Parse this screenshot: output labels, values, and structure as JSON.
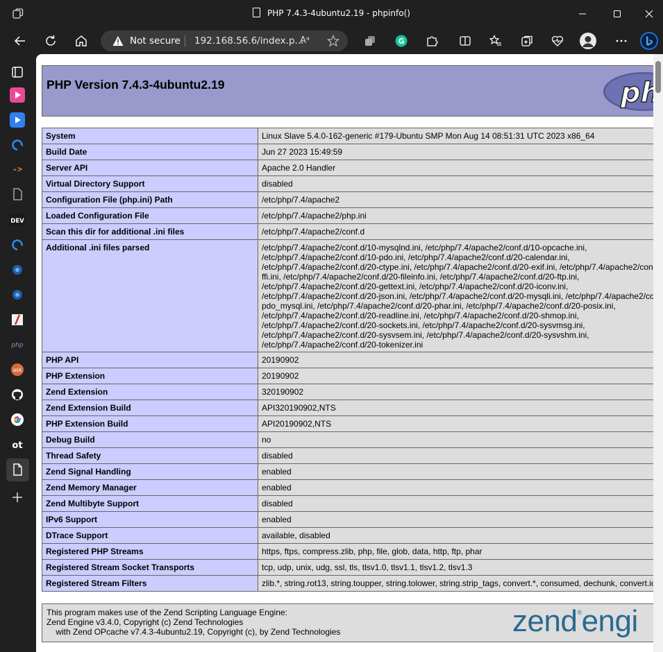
{
  "window": {
    "title": "PHP 7.4.3-4ubuntu2.19 - phpinfo()"
  },
  "toolbar": {
    "security_label": "Not secure",
    "url": "192.168.56.6/index.p...",
    "read_aloud_label": "Aᵃ"
  },
  "sidebar": {
    "items": [
      {
        "name": "tab-actions-icon"
      },
      {
        "name": "pink-app-icon"
      },
      {
        "name": "blue-app-icon"
      },
      {
        "name": "refresh-site-icon"
      },
      {
        "name": "arrow-site-icon"
      },
      {
        "name": "document-icon"
      },
      {
        "name": "dev-icon",
        "label": "DEV"
      },
      {
        "name": "site-icon-1"
      },
      {
        "name": "site-icon-2"
      },
      {
        "name": "site-icon-3"
      },
      {
        "name": "slash-site-icon"
      },
      {
        "name": "php-site-icon",
        "label": "php"
      },
      {
        "name": "ask-site-icon",
        "label": "ask"
      },
      {
        "name": "github-icon"
      },
      {
        "name": "google-icon"
      },
      {
        "name": "ot-icon",
        "label": "ot"
      },
      {
        "name": "page-icon"
      },
      {
        "name": "add-icon"
      }
    ]
  },
  "phpinfo": {
    "heading": "PHP Version 7.4.3-4ubuntu2.19",
    "rows": [
      {
        "key": "System",
        "value": "Linux Slave 5.4.0-162-generic #179-Ubuntu SMP Mon Aug 14 08:51:31 UTC 2023 x86_64"
      },
      {
        "key": "Build Date",
        "value": "Jun 27 2023 15:49:59"
      },
      {
        "key": "Server API",
        "value": "Apache 2.0 Handler"
      },
      {
        "key": "Virtual Directory Support",
        "value": "disabled"
      },
      {
        "key": "Configuration File (php.ini) Path",
        "value": "/etc/php/7.4/apache2"
      },
      {
        "key": "Loaded Configuration File",
        "value": "/etc/php/7.4/apache2/php.ini"
      },
      {
        "key": "Scan this dir for additional .ini files",
        "value": "/etc/php/7.4/apache2/conf.d"
      },
      {
        "key": "Additional .ini files parsed",
        "lines": [
          "/etc/php/7.4/apache2/conf.d/10-mysqlnd.ini, /etc/php/7.4/apache2/conf.d/10-opcache.ini,",
          "/etc/php/7.4/apache2/conf.d/10-pdo.ini, /etc/php/7.4/apache2/conf.d/20-calendar.ini,",
          "/etc/php/7.4/apache2/conf.d/20-ctype.ini, /etc/php/7.4/apache2/conf.d/20-exif.ini, /etc/php/7.4/apache2/con",
          "ffi.ini, /etc/php/7.4/apache2/conf.d/20-fileinfo.ini, /etc/php/7.4/apache2/conf.d/20-ftp.ini,",
          "/etc/php/7.4/apache2/conf.d/20-gettext.ini, /etc/php/7.4/apache2/conf.d/20-iconv.ini,",
          "/etc/php/7.4/apache2/conf.d/20-json.ini, /etc/php/7.4/apache2/conf.d/20-mysqli.ini, /etc/php/7.4/apache2/co",
          "pdo_mysql.ini, /etc/php/7.4/apache2/conf.d/20-phar.ini, /etc/php/7.4/apache2/conf.d/20-posix.ini,",
          "/etc/php/7.4/apache2/conf.d/20-readline.ini, /etc/php/7.4/apache2/conf.d/20-shmop.ini,",
          "/etc/php/7.4/apache2/conf.d/20-sockets.ini, /etc/php/7.4/apache2/conf.d/20-sysvmsg.ini,",
          "/etc/php/7.4/apache2/conf.d/20-sysvsem.ini, /etc/php/7.4/apache2/conf.d/20-sysvshm.ini,",
          "/etc/php/7.4/apache2/conf.d/20-tokenizer.ini"
        ]
      },
      {
        "key": "PHP API",
        "value": "20190902"
      },
      {
        "key": "PHP Extension",
        "value": "20190902"
      },
      {
        "key": "Zend Extension",
        "value": "320190902"
      },
      {
        "key": "Zend Extension Build",
        "value": "API320190902,NTS"
      },
      {
        "key": "PHP Extension Build",
        "value": "API20190902,NTS"
      },
      {
        "key": "Debug Build",
        "value": "no"
      },
      {
        "key": "Thread Safety",
        "value": "disabled"
      },
      {
        "key": "Zend Signal Handling",
        "value": "enabled"
      },
      {
        "key": "Zend Memory Manager",
        "value": "enabled"
      },
      {
        "key": "Zend Multibyte Support",
        "value": "disabled"
      },
      {
        "key": "IPv6 Support",
        "value": "enabled"
      },
      {
        "key": "DTrace Support",
        "value": "available, disabled"
      },
      {
        "key": "Registered PHP Streams",
        "value": "https, ftps, compress.zlib, php, file, glob, data, http, ftp, phar"
      },
      {
        "key": "Registered Stream Socket Transports",
        "value": "tcp, udp, unix, udg, ssl, tls, tlsv1.0, tlsv1.1, tlsv1.2, tlsv1.3"
      },
      {
        "key": "Registered Stream Filters",
        "value": "zlib.*, string.rot13, string.toupper, string.tolower, string.strip_tags, convert.*, consumed, dechunk, convert.ic"
      }
    ],
    "zend": {
      "lines": [
        "This program makes use of the Zend Scripting Language Engine:",
        "Zend Engine v3.4.0, Copyright (c) Zend Technologies",
        "    with Zend OPcache v7.4.3-4ubuntu2.19, Copyright (c), by Zend Technologies"
      ],
      "logo_text": "zend",
      "logo_text_2": "engi",
      "logo_mark": "®"
    }
  },
  "colors": {
    "php_header": "#9999cc",
    "key_cell": "#ccccff",
    "value_cell": "#dddddd",
    "zend_blue": "#2a6a8e",
    "chrome_bg": "#202020"
  }
}
